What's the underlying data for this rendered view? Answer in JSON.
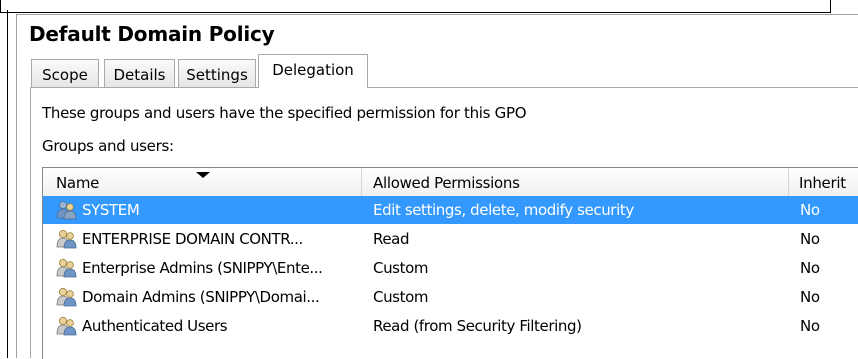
{
  "window": {
    "title": "Default Domain Policy"
  },
  "tabs": [
    {
      "label": "Scope",
      "active": false
    },
    {
      "label": "Details",
      "active": false
    },
    {
      "label": "Settings",
      "active": false
    },
    {
      "label": "Delegation",
      "active": true
    }
  ],
  "delegation": {
    "description": "These groups and users have the specified permission for this GPO",
    "list_label": "Groups and users:",
    "columns": [
      "Name",
      "Allowed Permissions",
      "Inherit"
    ],
    "rows": [
      {
        "name": "SYSTEM",
        "permissions": "Edit settings, delete, modify security",
        "inherited": "No",
        "selected": true,
        "icon": "group-icon"
      },
      {
        "name": "ENTERPRISE DOMAIN CONTR...",
        "permissions": "Read",
        "inherited": "No",
        "selected": false,
        "icon": "group-icon"
      },
      {
        "name": "Enterprise Admins (SNIPPY\\Ente...",
        "permissions": "Custom",
        "inherited": "No",
        "selected": false,
        "icon": "group-icon"
      },
      {
        "name": "Domain Admins (SNIPPY\\Domai...",
        "permissions": "Custom",
        "inherited": "No",
        "selected": false,
        "icon": "group-icon"
      },
      {
        "name": "Authenticated Users",
        "permissions": "Read (from Security Filtering)",
        "inherited": "No",
        "selected": false,
        "icon": "group-icon"
      }
    ]
  },
  "colors": {
    "selection": "#3399ff",
    "border": "#828790"
  }
}
